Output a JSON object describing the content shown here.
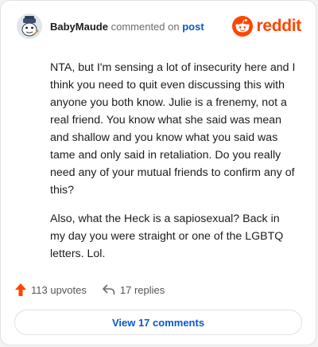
{
  "comment": {
    "username": "BabyMaude",
    "action_text": "commented on",
    "post_link": "post",
    "paragraphs": [
      "NTA, but I'm sensing a lot of insecurity here and I think you need to quit even discussing this with anyone you both know. Julie is a frenemy, not a real friend. You know what she said was mean and shallow and you know what you said was tame and only said in retaliation. Do you really need any of your mutual friends to confirm any of this?",
      "Also, what the Heck is a sapiosexual? Back in my day you were straight or one of the LGBTQ letters. Lol."
    ]
  },
  "brand": {
    "name": "reddit",
    "color": "#ff4500"
  },
  "stats": {
    "upvotes_label": "113 upvotes",
    "replies_label": "17 replies"
  },
  "view_comments_label": "View 17 comments",
  "colors": {
    "accent": "#ff4500",
    "link": "#0a58ca"
  },
  "icons": {
    "avatar": "snoo-avatar-icon",
    "brand": "reddit-logo-icon",
    "upvote": "upvote-arrow-icon",
    "reply": "reply-arrow-icon"
  }
}
